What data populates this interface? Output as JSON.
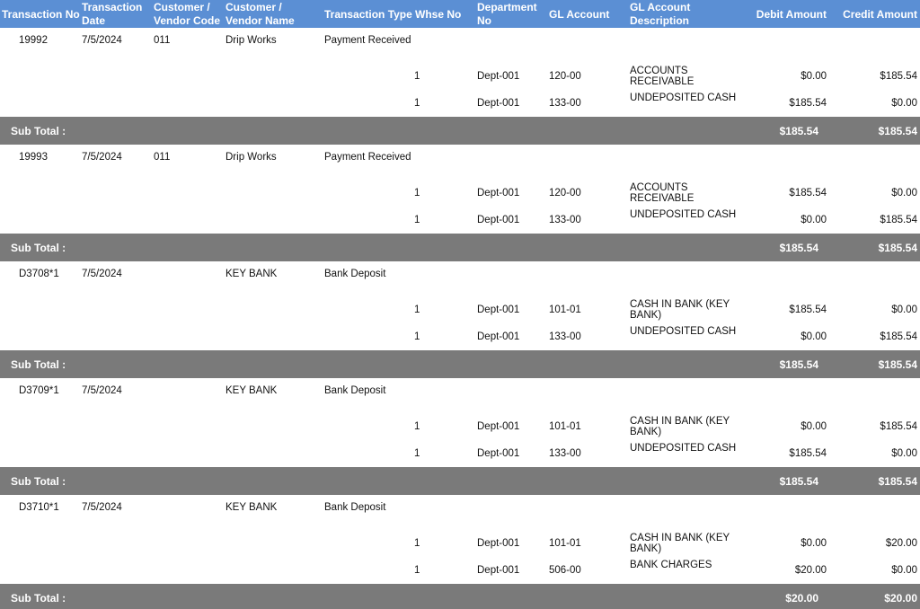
{
  "header": {
    "transaction_no": "Transaction No",
    "transaction_date": "Transaction\nDate",
    "customer_vendor_code": "Customer /\nVendor Code",
    "customer_vendor_name": "Customer /\nVendor Name",
    "transaction_type": "Transaction Type",
    "whse_no": "Whse No",
    "department_no": "Department\nNo",
    "gl_account": "GL Account",
    "gl_account_description": "GL Account\nDescription",
    "debit_amount": "Debit Amount",
    "credit_amount": "Credit Amount"
  },
  "subtotal_label": "Sub Total :",
  "transactions": [
    {
      "transaction_no": "19992",
      "date": "7/5/2024",
      "code": "011",
      "name": "Drip Works",
      "type": "Payment Received",
      "lines": [
        {
          "whse": "1",
          "dept": "Dept-001",
          "gl": "120-00",
          "desc": "ACCOUNTS RECEIVABLE",
          "debit": "$0.00",
          "credit": "$185.54"
        },
        {
          "whse": "1",
          "dept": "Dept-001",
          "gl": "133-00",
          "desc": "UNDEPOSITED CASH",
          "debit": "$185.54",
          "credit": "$0.00"
        }
      ],
      "subtotal_debit": "$185.54",
      "subtotal_credit": "$185.54"
    },
    {
      "transaction_no": "19993",
      "date": "7/5/2024",
      "code": "011",
      "name": "Drip Works",
      "type": "Payment Received",
      "lines": [
        {
          "whse": "1",
          "dept": "Dept-001",
          "gl": "120-00",
          "desc": "ACCOUNTS RECEIVABLE",
          "debit": "$185.54",
          "credit": "$0.00"
        },
        {
          "whse": "1",
          "dept": "Dept-001",
          "gl": "133-00",
          "desc": "UNDEPOSITED CASH",
          "debit": "$0.00",
          "credit": "$185.54"
        }
      ],
      "subtotal_debit": "$185.54",
      "subtotal_credit": "$185.54"
    },
    {
      "transaction_no": "D3708*1",
      "date": "7/5/2024",
      "code": "",
      "name": "KEY BANK",
      "type": "Bank Deposit",
      "lines": [
        {
          "whse": "1",
          "dept": "Dept-001",
          "gl": "101-01",
          "desc": "CASH IN BANK (KEY BANK)",
          "debit": "$185.54",
          "credit": "$0.00"
        },
        {
          "whse": "1",
          "dept": "Dept-001",
          "gl": "133-00",
          "desc": "UNDEPOSITED CASH",
          "debit": "$0.00",
          "credit": "$185.54"
        }
      ],
      "subtotal_debit": "$185.54",
      "subtotal_credit": "$185.54"
    },
    {
      "transaction_no": "D3709*1",
      "date": "7/5/2024",
      "code": "",
      "name": "KEY BANK",
      "type": "Bank Deposit",
      "lines": [
        {
          "whse": "1",
          "dept": "Dept-001",
          "gl": "101-01",
          "desc": "CASH IN BANK (KEY BANK)",
          "debit": "$0.00",
          "credit": "$185.54"
        },
        {
          "whse": "1",
          "dept": "Dept-001",
          "gl": "133-00",
          "desc": "UNDEPOSITED CASH",
          "debit": "$185.54",
          "credit": "$0.00"
        }
      ],
      "subtotal_debit": "$185.54",
      "subtotal_credit": "$185.54"
    },
    {
      "transaction_no": "D3710*1",
      "date": "7/5/2024",
      "code": "",
      "name": "KEY BANK",
      "type": "Bank Deposit",
      "lines": [
        {
          "whse": "1",
          "dept": "Dept-001",
          "gl": "101-01",
          "desc": "CASH IN BANK (KEY BANK)",
          "debit": "$0.00",
          "credit": "$20.00"
        },
        {
          "whse": "1",
          "dept": "Dept-001",
          "gl": "506-00",
          "desc": "BANK CHARGES",
          "debit": "$20.00",
          "credit": "$0.00"
        }
      ],
      "subtotal_debit": "$20.00",
      "subtotal_credit": "$20.00"
    }
  ]
}
